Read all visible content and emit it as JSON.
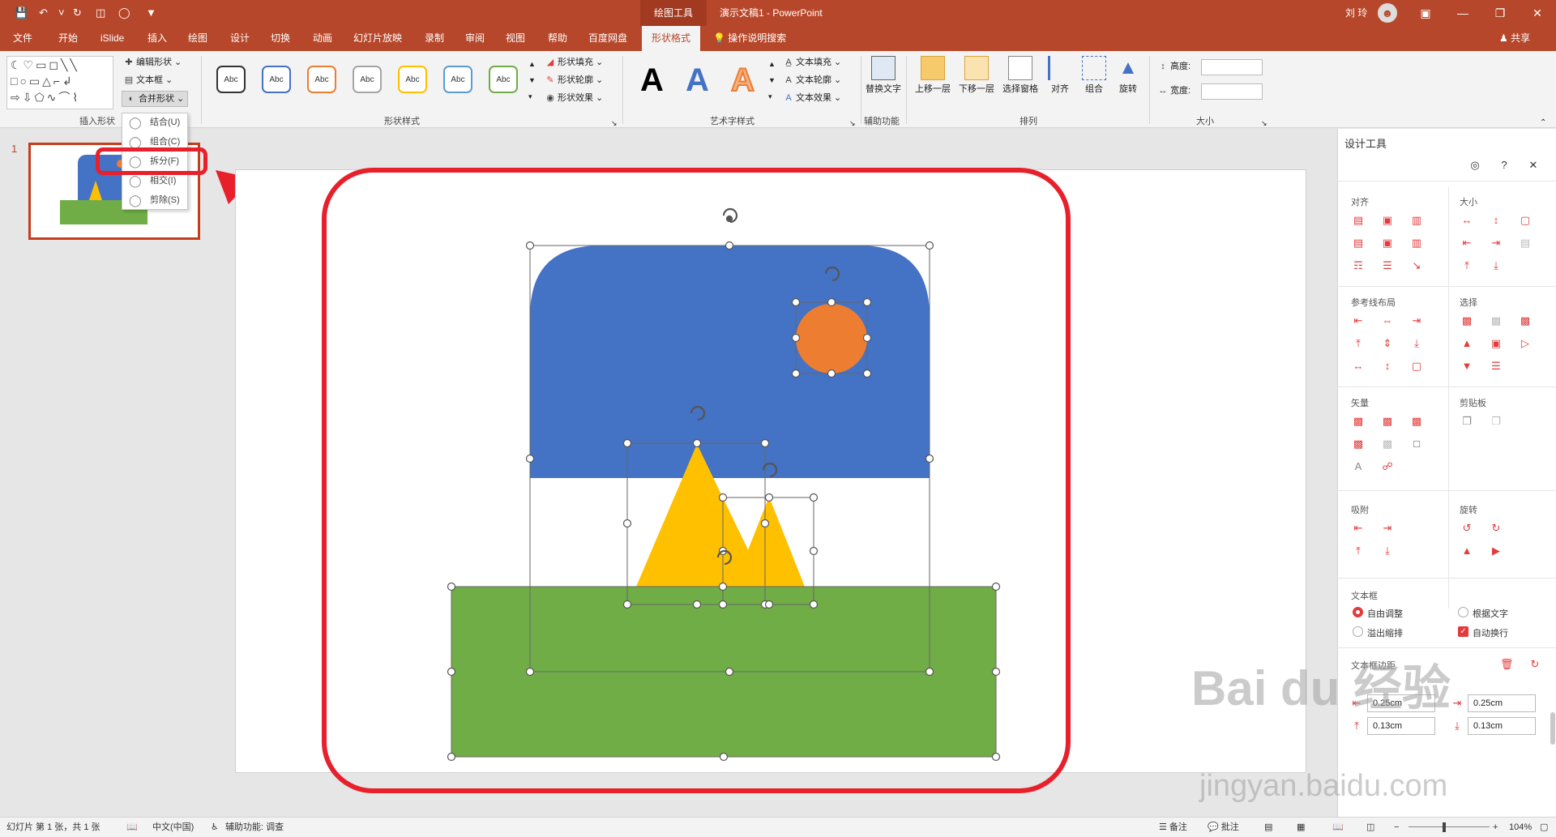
{
  "app": {
    "context_tab": "绘图工具",
    "doc_title": "演示文稿1 - PowerPoint",
    "user": "刘 玲",
    "share": "共享"
  },
  "tabs": [
    "文件",
    "开始",
    "iSlide",
    "插入",
    "绘图",
    "设计",
    "切换",
    "动画",
    "幻灯片放映",
    "录制",
    "审阅",
    "视图",
    "帮助",
    "百度网盘",
    "形状格式"
  ],
  "tell_me": "操作说明搜索",
  "ribbon": {
    "insert_shapes": {
      "label": "插入形状",
      "edit_shape": "编辑形状",
      "text_box": "文本框",
      "merge_shapes": "合并形状"
    },
    "shape_styles": {
      "label": "形状样式",
      "sample": "Abc",
      "fill": "形状填充",
      "outline": "形状轮廓",
      "effect": "形状效果",
      "sample_colors": [
        "#333333",
        "#4472c4",
        "#ed7d31",
        "#a5a5a5",
        "#ffc000",
        "#5b9bd5",
        "#70ad47"
      ]
    },
    "wordart": {
      "label": "艺术字样式",
      "letter": "A",
      "fill": "文本填充",
      "outline": "文本轮廓",
      "effect": "文本效果"
    },
    "accessibility": {
      "label": "辅助功能",
      "alt_text": "替换文字"
    },
    "arrange": {
      "label": "排列",
      "bring_forward": "上移一层",
      "send_backward": "下移一层",
      "selection_pane": "选择窗格",
      "align": "对齐",
      "group": "组合",
      "rotate": "旋转"
    },
    "size": {
      "label": "大小",
      "height": "高度:",
      "width": "宽度:"
    }
  },
  "merge_menu": {
    "items": [
      "结合(U)",
      "组合(C)",
      "拆分(F)",
      "相交(I)",
      "剪除(S)"
    ]
  },
  "thumbnail": {
    "slide_number": "1"
  },
  "design_pane": {
    "title": "设计工具",
    "sections": {
      "align": "对齐",
      "size": "大小",
      "guides": "参考线布局",
      "select": "选择",
      "vector": "矢量",
      "clipboard": "剪贴板",
      "snap": "吸附",
      "rotate": "旋转",
      "textbox": "文本框",
      "margins": "文本框边距"
    },
    "textbox_options": {
      "free_adjust": "自由调整",
      "fit_text": "根据文字",
      "overflow": "溢出缩排",
      "auto_wrap": "自动换行"
    },
    "margins": [
      "0.25cm",
      "0.25cm",
      "0.13cm",
      "0.13cm"
    ]
  },
  "watermark": {
    "line1": "Bai du 经验",
    "line2": "jingyan.baidu.com"
  },
  "status": {
    "slide_info": "幻灯片 第 1 张，共 1 张",
    "language": "中文(中国)",
    "accessibility": "辅助功能: 调查",
    "notes": "备注",
    "comments": "批注",
    "zoom": "104%"
  },
  "colors": {
    "accent": "#b7472a",
    "sky": "#4472c4",
    "sun": "#ed7d31",
    "mountain": "#ffc000",
    "grass": "#70ad47",
    "highlight": "#e8202b"
  }
}
